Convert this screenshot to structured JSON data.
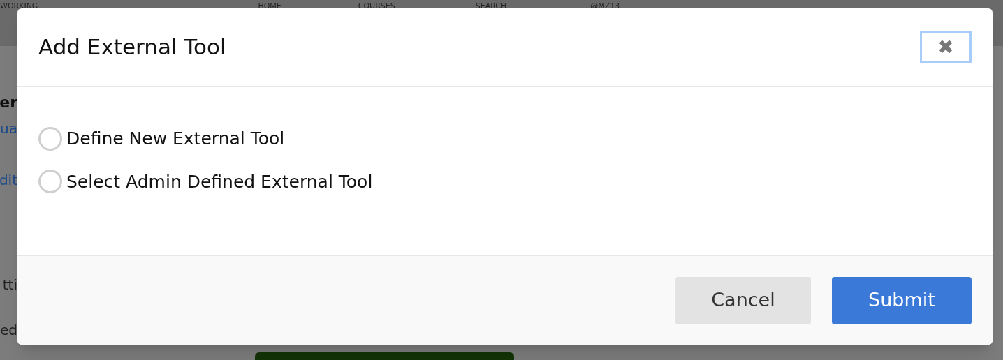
{
  "background": {
    "nav": [
      "WORKING",
      "HOME",
      "COURSES",
      "SEARCH",
      "@MZ13"
    ],
    "side_texts": [
      {
        "text": "er",
        "kind": "heading"
      },
      {
        "text": "ua",
        "kind": "link"
      },
      {
        "text": "dit",
        "kind": "link"
      },
      {
        "text": "tti",
        "kind": "plain"
      },
      {
        "text": "ed",
        "kind": "plain"
      }
    ]
  },
  "dialog": {
    "title": "Add External Tool",
    "close": "✖",
    "options": [
      {
        "label": "Define New External Tool",
        "selected": false
      },
      {
        "label": "Select Admin Defined External Tool",
        "selected": false
      }
    ],
    "buttons": [
      {
        "label": "Cancel",
        "kind": "secondary"
      },
      {
        "label": "Submit",
        "kind": "primary"
      }
    ]
  }
}
